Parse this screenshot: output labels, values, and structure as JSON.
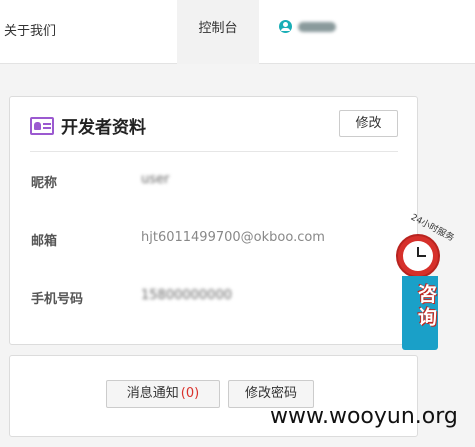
{
  "nav": {
    "about": "关于我们",
    "console": "控制台",
    "user_name": "user"
  },
  "profile": {
    "title": "开发者资料",
    "edit_label": "修改",
    "fields": [
      {
        "label": "昵称",
        "value": "user"
      },
      {
        "label": "邮箱",
        "value": "hjt6011499700@okboo.com"
      },
      {
        "label": "手机号码",
        "value": "15800000000"
      }
    ]
  },
  "actions": {
    "messages_label": "消息通知",
    "messages_count": "(0)",
    "password_label": "修改密码"
  },
  "consult_widget": {
    "ribbon": "24小时服务",
    "label": "咨询"
  },
  "watermark": "www.wooyun.org"
}
